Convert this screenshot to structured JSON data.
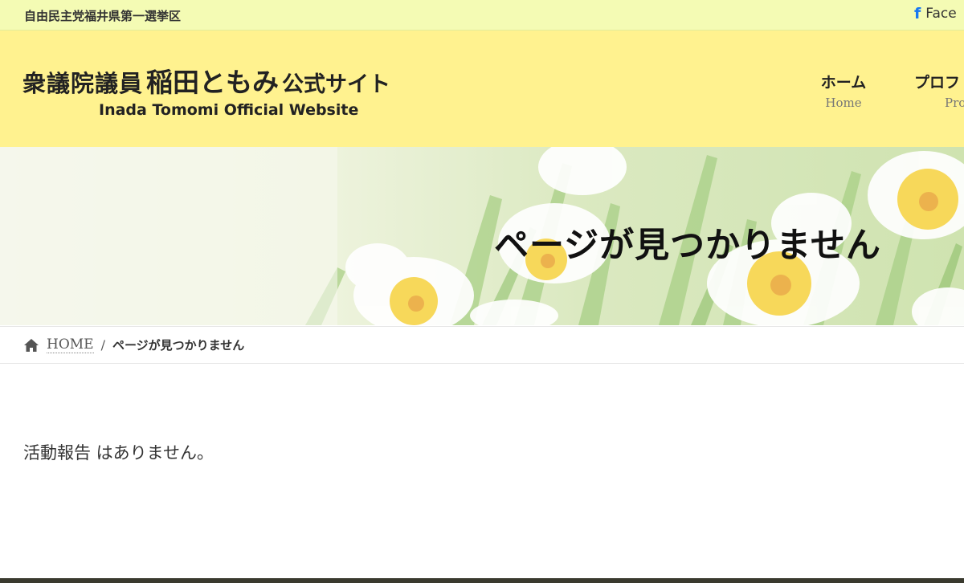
{
  "topbar": {
    "district": "自由民主党福井県第一選挙区",
    "facebook_label": "Face",
    "facebook_icon": "facebook-icon"
  },
  "header": {
    "logo_jp_prefix": "衆議院議員",
    "logo_jp_name": "稲田ともみ",
    "logo_jp_suffix": "公式サイト",
    "logo_en": "Inada Tomomi Official Website"
  },
  "nav": {
    "items": [
      {
        "label": "ホーム",
        "sub": "Home"
      },
      {
        "label": "プロフ",
        "sub": "Pro"
      }
    ]
  },
  "hero": {
    "title": "ページが見つかりません"
  },
  "breadcrumb": {
    "home_icon": "home-icon",
    "home": "HOME",
    "separator": "/",
    "current": "ページが見つかりません"
  },
  "main": {
    "message": "活動報告 はありません。"
  },
  "colors": {
    "topbar_bg": "#f4fbb4",
    "header_bg": "#fff28f",
    "facebook_blue": "#1877f2",
    "footer": "#3a3a2e"
  }
}
